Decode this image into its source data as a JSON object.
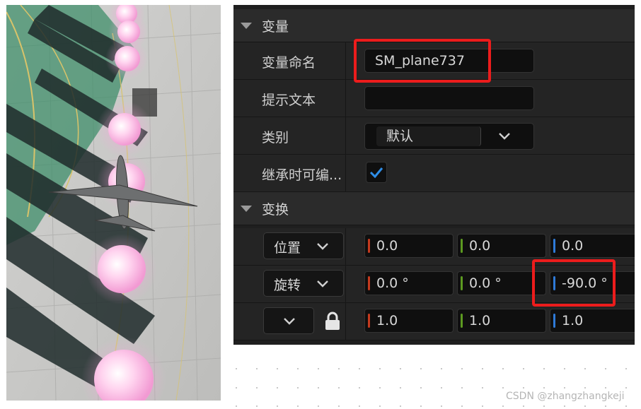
{
  "details": {
    "section_variable": {
      "title": "变量"
    },
    "variable_name": {
      "label": "变量命名",
      "value": "SM_plane737"
    },
    "tooltip": {
      "label": "提示文本",
      "value": ""
    },
    "category": {
      "label": "类别",
      "value": "默认"
    },
    "inherit_editable": {
      "label": "继承时可编...",
      "checked": true
    },
    "section_transform": {
      "title": "变换"
    },
    "location": {
      "mode": "位置",
      "x": "0.0",
      "y": "0.0",
      "z": "0.0"
    },
    "rotation": {
      "mode": "旋转",
      "x": "0.0 °",
      "y": "0.0 °",
      "z": "-90.0 °"
    },
    "scale": {
      "mode": "",
      "x": "1.0",
      "y": "1.0",
      "z": "1.0",
      "locked": true
    }
  },
  "watermark": "CSDN @zhangzhangkeji",
  "colors": {
    "axis_x": "#c43a1e",
    "axis_y": "#5c9a20",
    "axis_z": "#2e7ad8",
    "highlight": "#ec1c1c",
    "checkbox": "#2e8ee8"
  }
}
